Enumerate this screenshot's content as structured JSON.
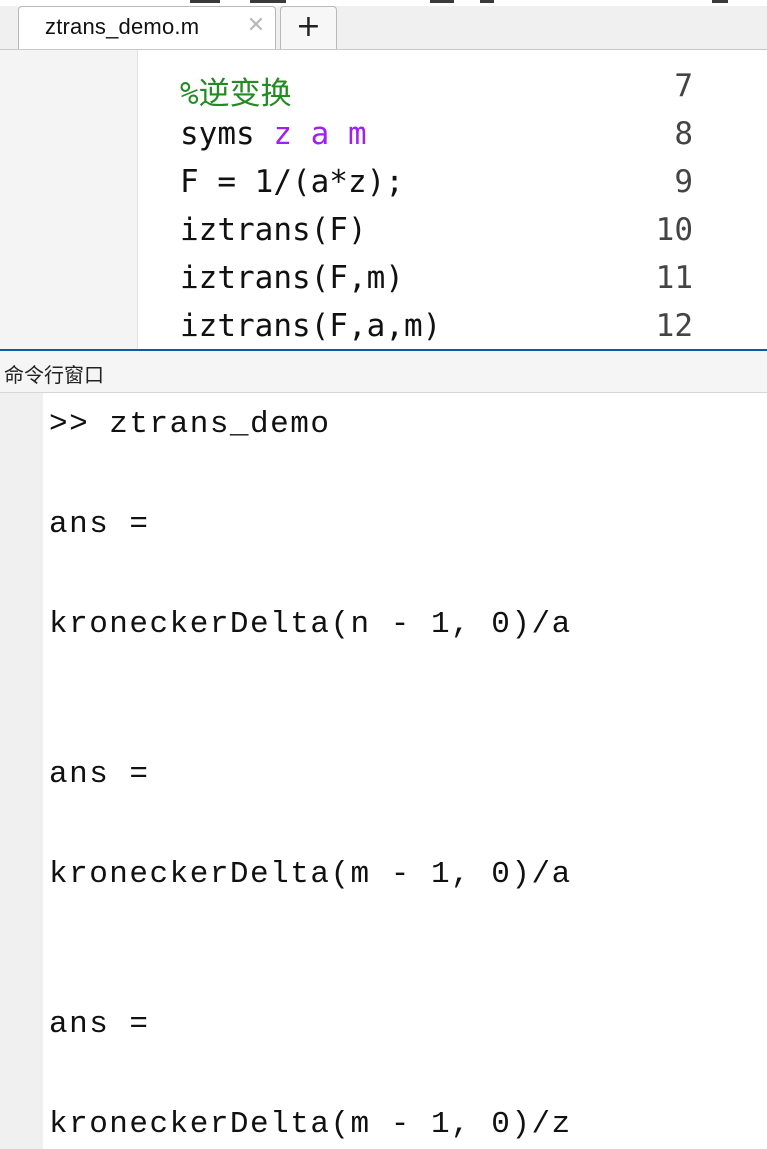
{
  "tab": {
    "filename": "ztrans_demo.m",
    "close_icon": "close-icon",
    "add_icon": "plus-icon"
  },
  "editor": {
    "lines": [
      {
        "number": "7",
        "parts": [
          {
            "text": "%逆变换",
            "kind": "comment"
          }
        ]
      },
      {
        "number": "8",
        "parts": [
          {
            "text": "syms ",
            "kind": "plain"
          },
          {
            "text": "z a m",
            "kind": "keyword-arg"
          }
        ]
      },
      {
        "number": "9",
        "parts": [
          {
            "text": "F = 1/(a*z);",
            "kind": "plain"
          }
        ]
      },
      {
        "number": "10",
        "parts": [
          {
            "text": "iztrans(F)",
            "kind": "plain"
          }
        ]
      },
      {
        "number": "11",
        "parts": [
          {
            "text": "iztrans(F,m)",
            "kind": "plain"
          }
        ]
      },
      {
        "number": "12",
        "parts": [
          {
            "text": "iztrans(F,a,m)",
            "kind": "plain"
          }
        ]
      }
    ],
    "colors": {
      "comment": "#228B22",
      "keyword_arg": "#a020f0"
    }
  },
  "command_window": {
    "title": "命令行窗口",
    "prompt_line": ">> ztrans_demo",
    "outputs": [
      {
        "label": "ans =",
        "value": "kroneckerDelta(n - 1, 0)/a"
      },
      {
        "label": "ans =",
        "value": "kroneckerDelta(m - 1, 0)/a"
      },
      {
        "label": "ans =",
        "value": "kroneckerDelta(m - 1, 0)/z"
      }
    ]
  }
}
